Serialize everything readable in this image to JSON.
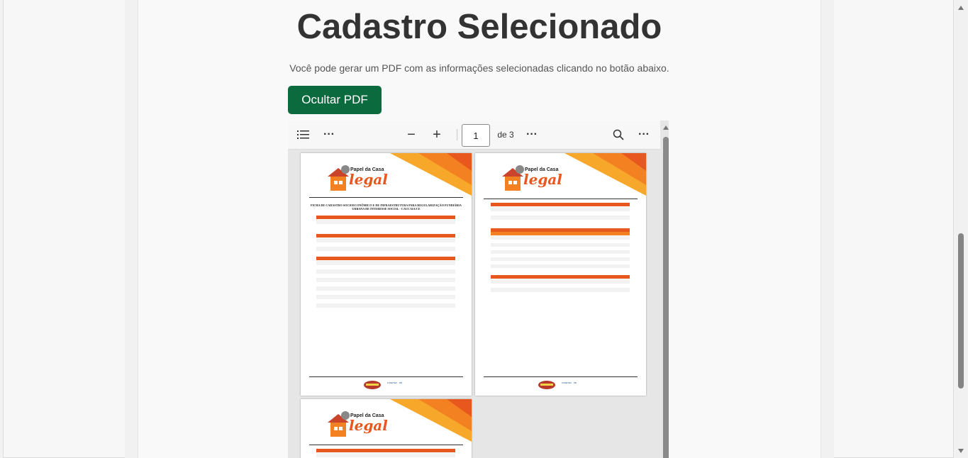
{
  "page": {
    "title": "Cadastro Selecionado",
    "subtitle": "Você pode gerar um PDF com as informações selecionadas clicando no botão abaixo.",
    "toggle_button": "Ocultar PDF"
  },
  "pdf_toolbar": {
    "page_number": "1",
    "page_total": "de 3",
    "icons": [
      "list-icon",
      "more-icon",
      "zoom-out-icon",
      "zoom-in-icon",
      "more-icon",
      "search-icon",
      "more-icon"
    ]
  },
  "pdf": {
    "logo_line1": "Papel da Casa",
    "logo_line2": "legal",
    "doc_title": "FICHA DE CADASTRO SOCIOECONÔMICO E DE INFRAESTRUTURA PARA REGULARIZAÇÃO FUNDIÁRIA URBANA DE INTERESSE SOCIAL - CAUCAIA/CE",
    "footer_brand": "FUNETEC · PB",
    "accent_color": "#e8571e"
  }
}
